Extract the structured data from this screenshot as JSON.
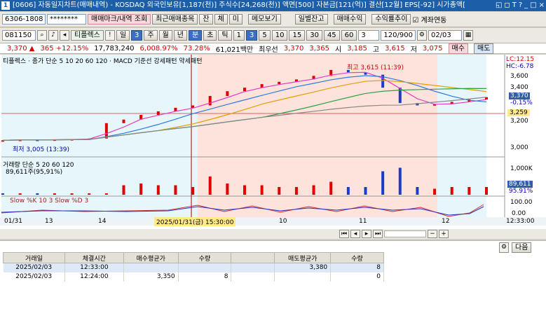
{
  "window": {
    "title": "[0606] 자동일지차트(매매내역) - KOSDAQ 외국인보유[1,187(천)] 주식수[24,268(천)] 액면[500] 자본금[121(억)] 결산[12월] EPS[-92] 시가총액[",
    "controls": [
      "◱",
      "◻",
      "T",
      "?",
      "_",
      "□",
      "×"
    ]
  },
  "toolbar1": {
    "account": "6306-1808",
    "password": "********",
    "buttons": [
      "매매마크/내역 조회",
      "최근매매종목",
      "잔",
      "체",
      "미",
      "메모보기",
      "일별잔고",
      "매매수익",
      "수익률추이"
    ],
    "checkbox_label": "계좌연동"
  },
  "toolbar2": {
    "code": "081150",
    "stock_name": "티플렉스",
    "periods": [
      "일",
      "3",
      "주",
      "월",
      "년",
      "분",
      "초",
      "틱"
    ],
    "intervals": [
      "1",
      "3",
      "5",
      "10",
      "15",
      "30",
      "45",
      "60"
    ],
    "count_val": "3",
    "range": "120/900",
    "date": "02/03"
  },
  "quote": {
    "price": "3,370 ▲",
    "change": "365 +12.15%",
    "volume": "17,783,240",
    "vol_ratio": "6,008.97%",
    "pct": "73.28%",
    "amount": "61,021백만",
    "best": "최우선",
    "bid1": "3,370",
    "bid2": "3,365",
    "open_label": "시",
    "open": "3,185",
    "high_label": "고",
    "high": "3,615",
    "low_label": "저",
    "low": "3,075",
    "buy": "매수",
    "sell": "매도"
  },
  "chart": {
    "legend": "티플렉스 · 종가 단순 5 10 20 60 120 · MACD 기준선 강세패턴 약세패턴",
    "high_annotation": "최고 3,615 (11:39)",
    "low_annotation": "최저 3,005 (13:39)",
    "lc": "LC:12.15",
    "hc": "HC:-6.78",
    "price_axis": [
      "3,600",
      "3,400",
      "3,200",
      "3,000"
    ],
    "tag_price": "3,370",
    "tag_pct": "-0.15%",
    "tag_line": "3,259",
    "volume_legend": "거래량 단순 5 20 60 120",
    "volume_val": "89,611주(95,91%)",
    "volume_axis": "1,000K",
    "vol_tag": "89,611",
    "vol_tag_pct": "95.91%",
    "slow_legend": "Slow %K 10 3  Slow %D 3",
    "slow_axis": [
      "100.00",
      "0.00"
    ],
    "x_labels": [
      "01/31",
      "13",
      "14",
      "10",
      "11",
      "12",
      "12:33:00"
    ],
    "cursor_time": "2025/01/31(금) 15:30:00",
    "chart_data": {
      "type": "line",
      "series": [
        {
          "values": [
            3005,
            3010,
            3008,
            3012,
            3015,
            3020,
            3150,
            3180,
            3220,
            3250,
            3280,
            3300,
            3380,
            3420,
            3450,
            3480,
            3500,
            3520,
            3550,
            3600,
            3580,
            3560,
            3450,
            3320,
            3300,
            3310,
            3330,
            3350,
            3370
          ]
        }
      ],
      "ylim": [
        2900,
        3700
      ]
    }
  },
  "bottom": {
    "button": "다음",
    "headers": [
      "거래일",
      "체결시간",
      "매수평균가",
      "수량",
      "매도평균가",
      "수량"
    ],
    "rows": [
      {
        "date": "2025/02/03",
        "time": "12:33:00",
        "buy_avg": "",
        "buy_qty": "",
        "sell_avg": "3,380",
        "sell_qty": "8"
      },
      {
        "date": "2025/02/03",
        "time": "12:24:00",
        "buy_avg": "3,350",
        "buy_qty": "8",
        "sell_avg": "",
        "sell_qty": "0"
      }
    ]
  }
}
